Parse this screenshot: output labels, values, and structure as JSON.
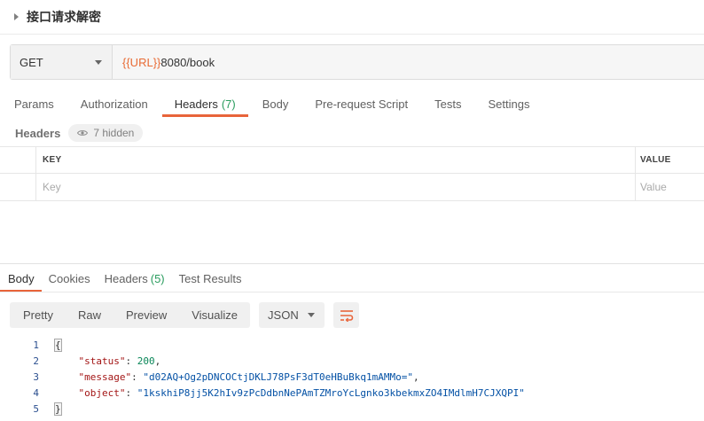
{
  "request": {
    "name": "接口请求解密",
    "method": "GET",
    "url_variable": "{{URL}}",
    "url_path": "8080/book"
  },
  "request_tabs": [
    {
      "label": "Params",
      "count": ""
    },
    {
      "label": "Authorization",
      "count": ""
    },
    {
      "label": "Headers",
      "count": "(7)"
    },
    {
      "label": "Body",
      "count": ""
    },
    {
      "label": "Pre-request Script",
      "count": ""
    },
    {
      "label": "Tests",
      "count": ""
    },
    {
      "label": "Settings",
      "count": ""
    }
  ],
  "active_request_tab": "Headers",
  "headers_section": {
    "label": "Headers",
    "hidden_text": "7 hidden"
  },
  "headers_table": {
    "columns": [
      "KEY",
      "VALUE"
    ],
    "key_placeholder": "Key",
    "value_placeholder": "Value"
  },
  "response_tabs": [
    {
      "label": "Body",
      "count": ""
    },
    {
      "label": "Cookies",
      "count": ""
    },
    {
      "label": "Headers",
      "count": "(5)"
    },
    {
      "label": "Test Results",
      "count": ""
    }
  ],
  "active_response_tab": "Body",
  "view_modes": [
    "Pretty",
    "Raw",
    "Preview",
    "Visualize"
  ],
  "selected_language": "JSON",
  "response_body": {
    "line_numbers": [
      "1",
      "2",
      "3",
      "4",
      "5"
    ],
    "open_brace": "{",
    "close_brace": "}",
    "fields": [
      {
        "key": "\"status\"",
        "value": "200",
        "type": "number",
        "trail": ","
      },
      {
        "key": "\"message\"",
        "value": "\"d02AQ+Og2pDNCOCtjDKLJ78PsF3dT0eHBuBkq1mAMMo=\"",
        "type": "string",
        "trail": ","
      },
      {
        "key": "\"object\"",
        "value": "\"1kskhiP8jj5K2hIv9zPcDdbnNePAmTZMroYcLgnko3kbekmxZO4IMdlmH7CJXQPI\"",
        "type": "string",
        "trail": ""
      }
    ]
  },
  "colors": {
    "accent": "#e8643a",
    "count_green": "#2a9c5e",
    "url_variable": "#e86b35"
  },
  "icons": [
    "caret-right-icon",
    "chevron-down-icon",
    "eye-icon",
    "wrap-lines-icon"
  ]
}
